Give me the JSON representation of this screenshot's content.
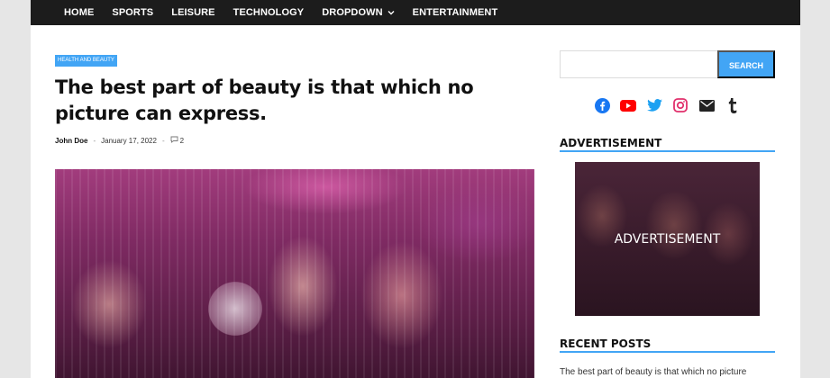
{
  "nav": {
    "items": [
      {
        "label": "HOME"
      },
      {
        "label": "SPORTS"
      },
      {
        "label": "LEISURE"
      },
      {
        "label": "TECHNOLOGY"
      },
      {
        "label": "DROPDOWN"
      },
      {
        "label": "ENTERTAINMENT"
      }
    ]
  },
  "post": {
    "category": "HEALTH AND BEAUTY",
    "title": "The best part of beauty is that which no picture can express.",
    "author": "John Doe",
    "date": "January 17, 2022",
    "comments": "2"
  },
  "sidebar": {
    "search_button": "SEARCH",
    "search_value": "",
    "social_icons": [
      "facebook-icon",
      "youtube-icon",
      "twitter-icon",
      "instagram-icon",
      "email-icon",
      "tumblr-icon"
    ],
    "advertisement_title": "ADVERTISEMENT",
    "advertisement_text": "ADVERTISEMENT",
    "recent_posts_title": "RECENT POSTS",
    "recent_posts": [
      "The best part of beauty is that which no picture"
    ]
  },
  "colors": {
    "accent": "#42a5f5",
    "topbar": "#1c1c1c",
    "facebook": "#1877f2",
    "youtube": "#ff0000",
    "twitter": "#1da1f2",
    "instagram": "#e1306c"
  }
}
